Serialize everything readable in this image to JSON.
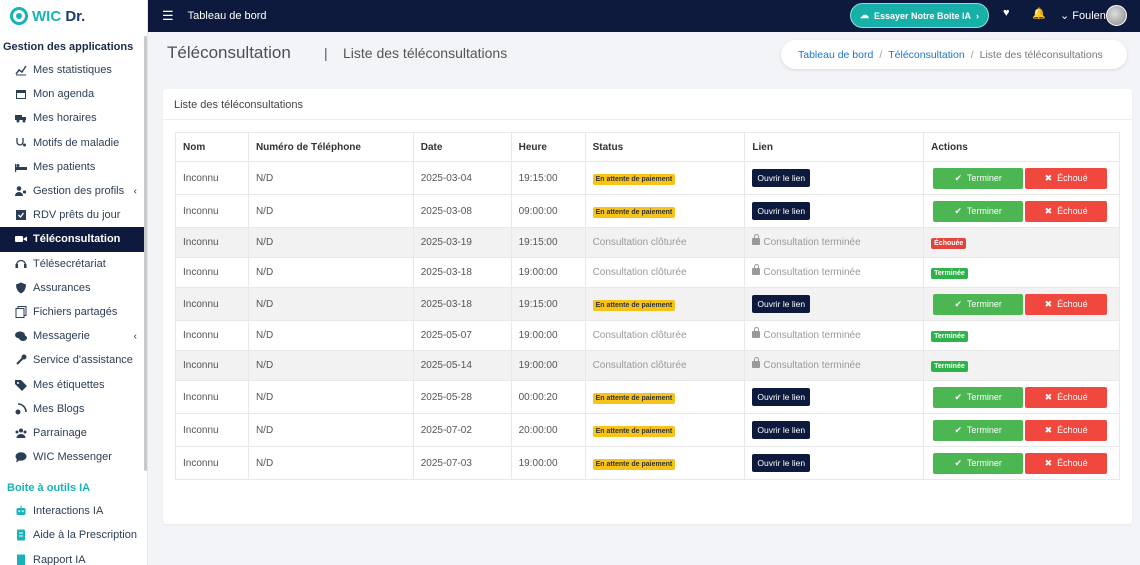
{
  "app": {
    "logo": "WIC Dr."
  },
  "sidebar": {
    "section1": "Gestion des applications",
    "items": [
      {
        "label": "Mes statistiques",
        "icon": "chart-line-icon"
      },
      {
        "label": "Mon agenda",
        "icon": "calendar-icon"
      },
      {
        "label": "Mes horaires",
        "icon": "truck-icon"
      },
      {
        "label": "Motifs de maladie",
        "icon": "stethoscope-icon"
      },
      {
        "label": "Mes patients",
        "icon": "bed-icon"
      },
      {
        "label": "Gestion des profils",
        "icon": "users-icon"
      },
      {
        "label": "RDV prêts du jour",
        "icon": "calendar-check-icon"
      },
      {
        "label": "Téléconsultation",
        "icon": "video-icon"
      },
      {
        "label": "Télésecrétariat",
        "icon": "headset-icon"
      },
      {
        "label": "Assurances",
        "icon": "shield-icon"
      },
      {
        "label": "Fichiers partagés",
        "icon": "files-icon"
      },
      {
        "label": "Messagerie",
        "icon": "comments-icon"
      },
      {
        "label": "Service d'assistance",
        "icon": "wrench-icon"
      },
      {
        "label": "Mes étiquettes",
        "icon": "tags-icon"
      },
      {
        "label": "Mes Blogs",
        "icon": "blog-icon"
      },
      {
        "label": "Parrainage",
        "icon": "people-group-icon"
      },
      {
        "label": "WIC Messenger",
        "icon": "chat-icon"
      }
    ],
    "section2": "Boite à outils IA",
    "ai_items": [
      {
        "label": "Interactions IA",
        "icon": "robot-icon"
      },
      {
        "label": "Aide à la Prescription",
        "icon": "prescription-icon"
      },
      {
        "label": "Rapport IA",
        "icon": "report-icon"
      }
    ]
  },
  "topbar": {
    "title": "Tableau de bord",
    "try_button": "Essayer Notre Boite IA",
    "user": "Foulen"
  },
  "header": {
    "title": "Téléconsultation",
    "separator": "|",
    "subtitle": "Liste des téléconsultations",
    "breadcrumb": [
      "Tableau de bord",
      "Téléconsultation",
      "Liste des téléconsultations"
    ]
  },
  "card": {
    "title": "Liste des téléconsultations",
    "columns": [
      "Nom",
      "Numéro de Téléphone",
      "Date",
      "Heure",
      "Status",
      "Lien",
      "Actions"
    ],
    "link_label": "Ouvrir le lien",
    "locked_label": "Consultation terminée",
    "btn_ok": "Terminer",
    "btn_fail": "Échoué",
    "rows": [
      {
        "nom": "Inconnu",
        "tel": "N/D",
        "date": "2025-03-04",
        "heure": "19:15:00",
        "status": "En attente de paiement"
      },
      {
        "nom": "Inconnu",
        "tel": "N/D",
        "date": "2025-03-08",
        "heure": "09:00:00",
        "status": "En attente de paiement"
      },
      {
        "nom": "Inconnu",
        "tel": "N/D",
        "date": "2025-03-19",
        "heure": "19:15:00",
        "status": "Consultation clôturée",
        "result": "Échouée"
      },
      {
        "nom": "Inconnu",
        "tel": "N/D",
        "date": "2025-03-18",
        "heure": "19:00:00",
        "status": "Consultation clôturée",
        "result": "Terminée"
      },
      {
        "nom": "Inconnu",
        "tel": "N/D",
        "date": "2025-03-18",
        "heure": "19:15:00",
        "status": "En attente de paiement"
      },
      {
        "nom": "Inconnu",
        "tel": "N/D",
        "date": "2025-05-07",
        "heure": "19:00:00",
        "status": "Consultation clôturée",
        "result": "Terminée"
      },
      {
        "nom": "Inconnu",
        "tel": "N/D",
        "date": "2025-05-14",
        "heure": "19:00:00",
        "status": "Consultation clôturée",
        "result": "Terminée"
      },
      {
        "nom": "Inconnu",
        "tel": "N/D",
        "date": "2025-05-28",
        "heure": "00:00:20",
        "status": "En attente de paiement"
      },
      {
        "nom": "Inconnu",
        "tel": "N/D",
        "date": "2025-07-02",
        "heure": "20:00:00",
        "status": "En attente de paiement"
      },
      {
        "nom": "Inconnu",
        "tel": "N/D",
        "date": "2025-07-03",
        "heure": "19:00:00",
        "status": "En attente de paiement"
      }
    ]
  },
  "colors": {
    "navy": "#0e1a3d",
    "teal": "#16b0a8",
    "green": "#4cb653",
    "red": "#f0483e",
    "yellow": "#f7c318"
  }
}
